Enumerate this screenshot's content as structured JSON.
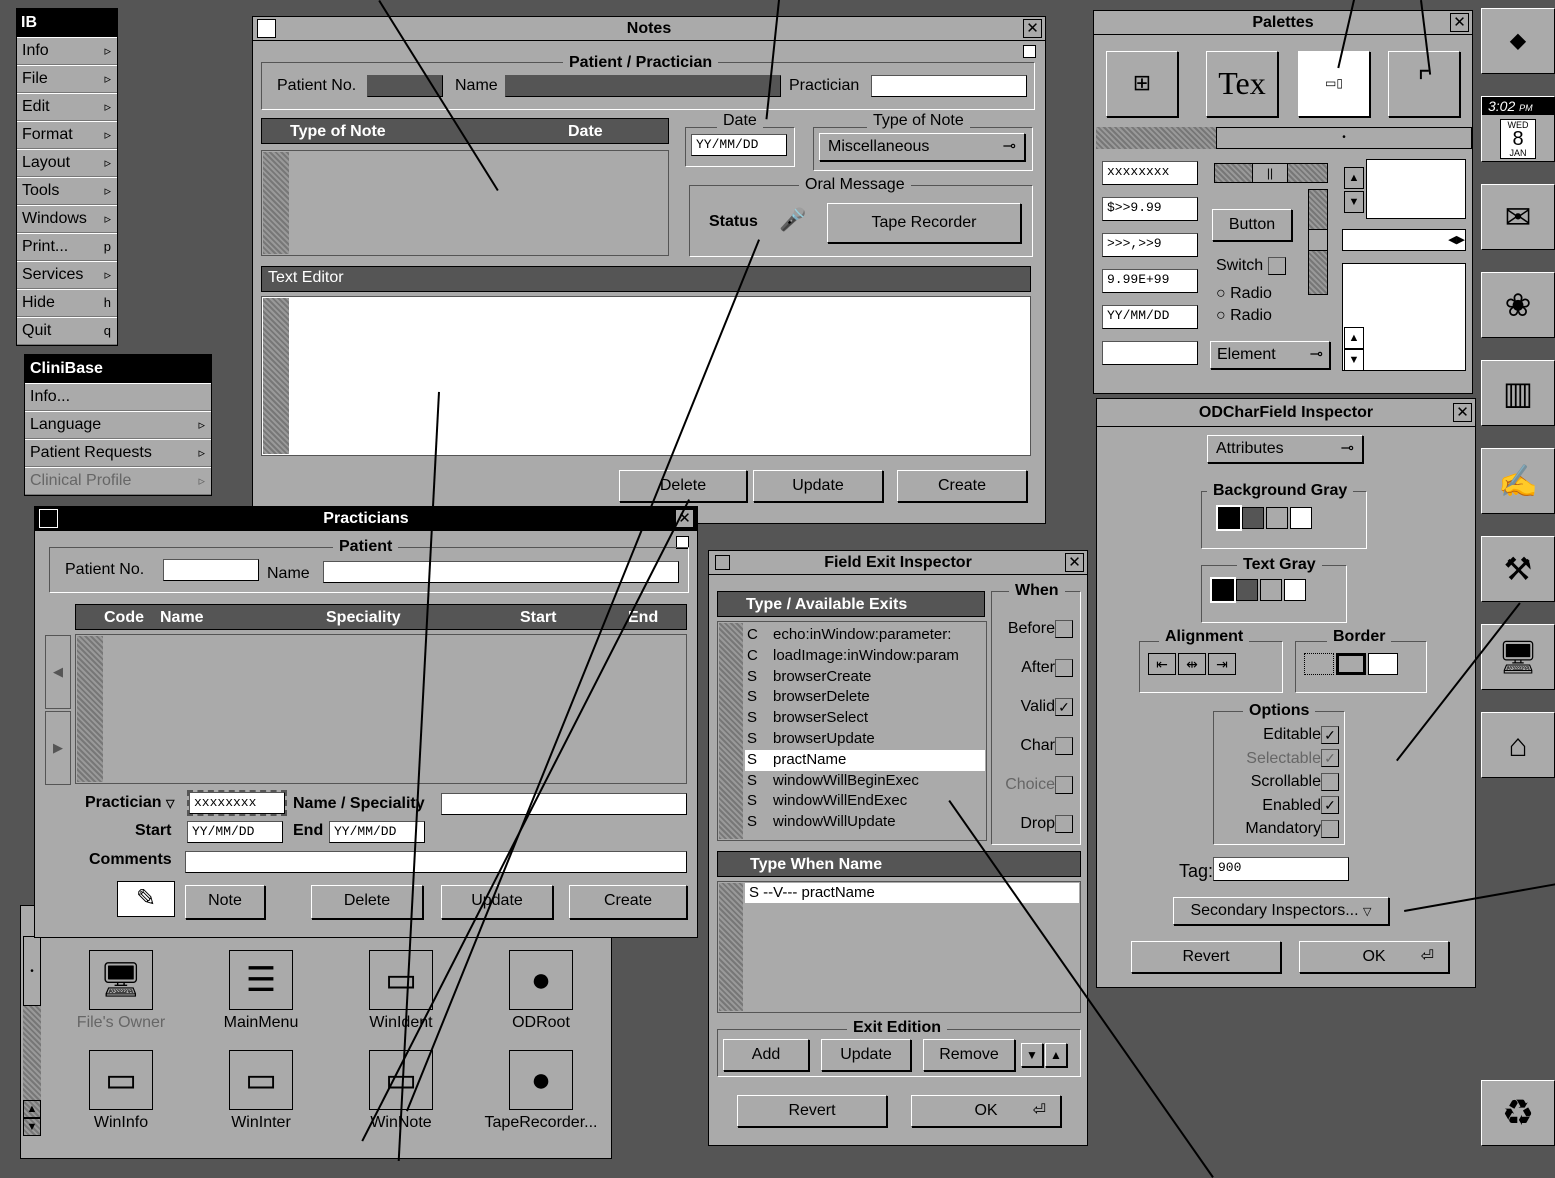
{
  "main_menu": {
    "title": "IB",
    "items": [
      {
        "label": "Info",
        "key": "▹"
      },
      {
        "label": "File",
        "key": "▹"
      },
      {
        "label": "Edit",
        "key": "▹"
      },
      {
        "label": "Format",
        "key": "▹"
      },
      {
        "label": "Layout",
        "key": "▹"
      },
      {
        "label": "Tools",
        "key": "▹"
      },
      {
        "label": "Windows",
        "key": "▹"
      },
      {
        "label": "Print...",
        "key": "p"
      },
      {
        "label": "Services",
        "key": "▹"
      },
      {
        "label": "Hide",
        "key": "h"
      },
      {
        "label": "Quit",
        "key": "q"
      }
    ]
  },
  "clinibase_menu": {
    "title": "CliniBase",
    "items": [
      {
        "label": "Info...",
        "key": ""
      },
      {
        "label": "Language",
        "key": "▹"
      },
      {
        "label": "Patient Requests",
        "key": "▹"
      },
      {
        "label": "Clinical Profile",
        "key": "▹"
      }
    ]
  },
  "notes": {
    "title": "Notes",
    "group_title": "Patient / Practician",
    "patient_no_label": "Patient No.",
    "name_label": "Name",
    "practician_label": "Practician",
    "table_col_type": "Type of Note",
    "table_col_date": "Date",
    "date_group": "Date",
    "date_value": "YY/MM/DD",
    "type_group": "Type of Note",
    "type_value": "Miscellaneous",
    "oral_group": "Oral Message",
    "status_label": "Status",
    "tape_button": "Tape Recorder",
    "text_editor": "Text Editor",
    "delete": "Delete",
    "update": "Update",
    "create": "Create"
  },
  "practicians": {
    "title": "Practicians",
    "group_title": "Patient",
    "patient_no_label": "Patient No.",
    "name_label": "Name",
    "cols": [
      "Code",
      "Name",
      "Speciality",
      "Start",
      "End"
    ],
    "practician_label": "Practician",
    "practician_value": "xxxxxxxx",
    "name_spec_label": "Name / Speciality",
    "start_label": "Start",
    "start_value": "YY/MM/DD",
    "end_label": "End",
    "end_value": "YY/MM/DD",
    "comments_label": "Comments",
    "note": "Note",
    "delete": "Delete",
    "update": "Update",
    "create": "Create"
  },
  "file_icons": [
    {
      "label": "File's Owner"
    },
    {
      "label": "MainMenu"
    },
    {
      "label": "WinIdent"
    },
    {
      "label": "ODRoot"
    },
    {
      "label": "WinInfo"
    },
    {
      "label": "WinInter"
    },
    {
      "label": "WinNote"
    },
    {
      "label": "TapeRecorder..."
    }
  ],
  "field_exit": {
    "title": "Field Exit Inspector",
    "list_header": "Type / Available Exits",
    "exits": [
      {
        "type": "C",
        "name": "echo:inWindow:parameter:"
      },
      {
        "type": "C",
        "name": "loadImage:inWindow:param"
      },
      {
        "type": "S",
        "name": "browserCreate"
      },
      {
        "type": "S",
        "name": "browserDelete"
      },
      {
        "type": "S",
        "name": "browserSelect"
      },
      {
        "type": "S",
        "name": "browserUpdate"
      },
      {
        "type": "S",
        "name": "practName"
      },
      {
        "type": "S",
        "name": "windowWillBeginExec"
      },
      {
        "type": "S",
        "name": "windowWillEndExec"
      },
      {
        "type": "S",
        "name": "windowWillUpdate"
      }
    ],
    "when_title": "When",
    "when": [
      {
        "label": "Before",
        "checked": ""
      },
      {
        "label": "After",
        "checked": ""
      },
      {
        "label": "Valid",
        "checked": "✓"
      },
      {
        "label": "Char",
        "checked": ""
      },
      {
        "label": "Choice",
        "checked": ""
      },
      {
        "label": "Drop",
        "checked": ""
      }
    ],
    "when_header": "Type When  Name",
    "when_row": "S  --V---  practName",
    "edition_title": "Exit Edition",
    "add": "Add",
    "update": "Update",
    "remove": "Remove",
    "revert": "Revert",
    "ok": "OK"
  },
  "palettes": {
    "title": "Palettes",
    "text_icon": "Tex",
    "fields": [
      "xxxxxxxx",
      "$>>9.99",
      ">>>,>>9",
      "9.99E+99",
      "YY/MM/DD",
      ""
    ],
    "button": "Button",
    "switch": "Switch",
    "radio1": "Radio",
    "radio2": "Radio",
    "element": "Element"
  },
  "odchar": {
    "title": "ODCharField Inspector",
    "attributes": "Attributes",
    "bg_gray": "Background Gray",
    "text_gray": "Text Gray",
    "alignment": "Alignment",
    "border": "Border",
    "options": "Options",
    "opts": [
      {
        "label": "Editable",
        "checked": "✓"
      },
      {
        "label": "Selectable",
        "checked": "✓"
      },
      {
        "label": "Scrollable",
        "checked": ""
      },
      {
        "label": "Enabled",
        "checked": "✓"
      },
      {
        "label": "Mandatory",
        "checked": ""
      }
    ],
    "tag_label": "Tag:",
    "tag_value": "900",
    "secondary": "Secondary Inspectors...",
    "revert": "Revert",
    "ok": "OK"
  },
  "dock": {
    "clock_time": "3:02",
    "clock_ampm": "PM",
    "cal_day": "WED",
    "cal_date": "8",
    "cal_month": "JAN"
  }
}
